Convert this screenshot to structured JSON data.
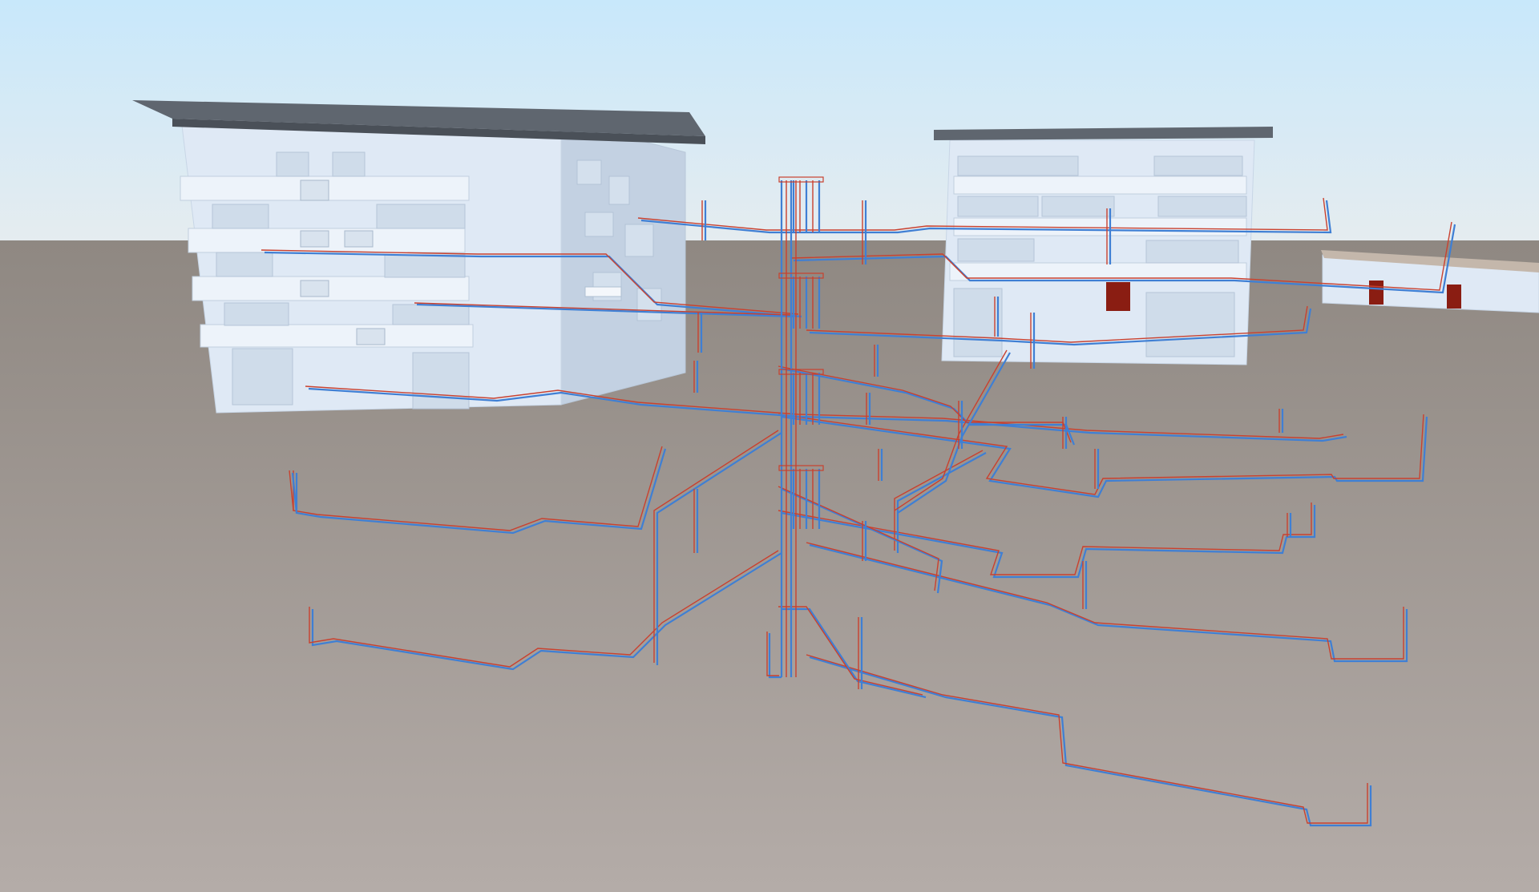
{
  "viewport": {
    "kind": "3d-model-viewer",
    "colors": {
      "sky_top": "#c8e8fb",
      "sky_bottom": "#e6ecef",
      "ground_near": "#b4aca8",
      "ground_far": "#8f8882",
      "building_wall": "#dfe9f5",
      "building_shadow": "#c3d1e2",
      "roof": "#5f666f",
      "supply_pipe": "#3f7fd4",
      "return_pipe": "#c9412f",
      "door_accent": "#8a1d12"
    }
  },
  "scene": {
    "objects": [
      {
        "name": "building-left",
        "type": "apartment-building",
        "floors": 4
      },
      {
        "name": "building-right",
        "type": "apartment-building",
        "floors": 4
      },
      {
        "name": "annex-building",
        "type": "low-building",
        "floors": 1
      },
      {
        "name": "riser-column",
        "type": "vertical-pipe-bundle"
      },
      {
        "name": "pipe-network",
        "type": "distribution-pipes",
        "loops": 4
      }
    ]
  }
}
